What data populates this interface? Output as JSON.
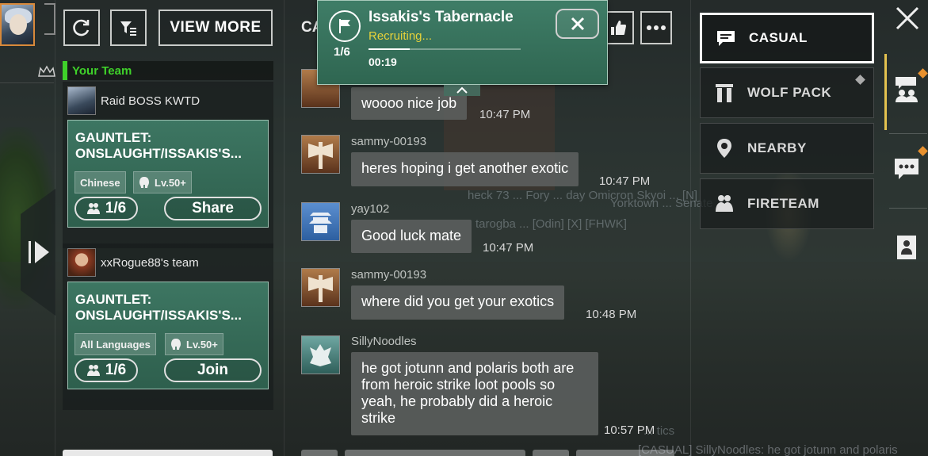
{
  "toolbar": {
    "view_more_label": "VIEW MORE"
  },
  "team_list": {
    "your_team_label": "Your Team",
    "teams": [
      {
        "leader": "Raid BOSS KWTD",
        "activity": "GAUNTLET: ONSLAUGHT/ISSAKIS'S...",
        "language": "Chinese",
        "level": "Lv.50+",
        "members": "1/6",
        "action_label": "Share"
      },
      {
        "leader": "xxRogue88's team",
        "activity": "GAUNTLET: ONSLAUGHT/ISSAKIS'S...",
        "language": "All Languages",
        "level": "Lv.50+",
        "members": "1/6",
        "action_label": "Join"
      }
    ]
  },
  "chat": {
    "title_partial": "CA",
    "messages": [
      {
        "user": "",
        "text": "woooo nice job",
        "time": "10:47 PM"
      },
      {
        "user": "sammy-00193",
        "text": "heres hoping i get another exotic",
        "time": "10:47 PM"
      },
      {
        "user": "yay102",
        "text": "Good luck mate",
        "time": "10:47 PM"
      },
      {
        "user": "sammy-00193",
        "text": "where did you get your exotics",
        "time": "10:48 PM"
      },
      {
        "user": "SillyNoodles",
        "text": "he got jotunn and polaris both are from heroic strike loot pools so yeah, he probably did a heroic strike",
        "time": "10:57 PM"
      }
    ],
    "ghost_lines": [
      "heck 73 ... Fory ... day Omicron Skyoi ... [N]",
      "Yorktown ... Senate",
      "tarogba ... [Odin] [X] [FHWK]",
      "... tics",
      "[CASUAL] SillyNoodles: he got jotunn and polaris"
    ]
  },
  "popup": {
    "title": "Issakis's Tabernacle",
    "status": "Recruiting...",
    "count": "1/6",
    "timer": "00:19",
    "progress": 0.27
  },
  "channels": [
    {
      "label": "CASUAL",
      "active": true,
      "icon": "chat-icon"
    },
    {
      "label": "WOLF PACK",
      "active": false,
      "icon": "wolfpack-icon"
    },
    {
      "label": "NEARBY",
      "active": false,
      "icon": "location-pin-icon"
    },
    {
      "label": "FIRETEAM",
      "active": false,
      "icon": "fireteam-icon"
    }
  ],
  "colors": {
    "accent_green": "#3fd12a",
    "card_green": "#3d7662",
    "status_yellow": "#e6d23a",
    "notification_orange": "#e8912e",
    "rail_highlight": "#e4c24f"
  }
}
